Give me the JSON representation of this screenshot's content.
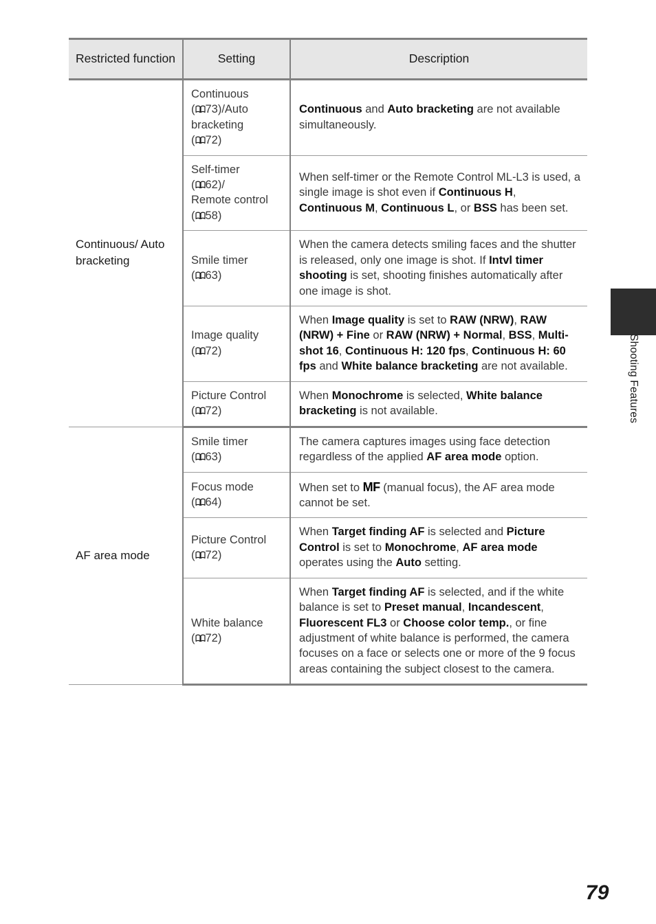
{
  "page": {
    "number": "79",
    "side_tab_label": "Shooting Features"
  },
  "table": {
    "headers": {
      "function": "Restricted function",
      "setting": "Setting",
      "description": "Description"
    },
    "groups": [
      {
        "function": "Continuous/ Auto bracketing",
        "rows": [
          {
            "setting_line1": "Continuous",
            "setting_ref1": "73",
            "setting_line1_suffix": ")/Auto",
            "setting_line2": "bracketing",
            "setting_ref2": "72",
            "description_runs": [
              {
                "t": "Continuous",
                "b": true
              },
              {
                "t": " and ",
                "b": false
              },
              {
                "t": "Auto bracketing",
                "b": true
              },
              {
                "t": " are not available simultaneously.",
                "b": false
              }
            ]
          },
          {
            "setting_line1": "Self-timer",
            "setting_ref1": "62",
            "setting_line1_suffix": ")/",
            "setting_line2": "Remote control",
            "setting_ref2": "58",
            "description_runs": [
              {
                "t": "When self-timer or the Remote Control ML-L3 is used, a single image is shot even if ",
                "b": false
              },
              {
                "t": "Continuous H",
                "b": true
              },
              {
                "t": ", ",
                "b": false
              },
              {
                "t": "Continuous M",
                "b": true
              },
              {
                "t": ", ",
                "b": false
              },
              {
                "t": "Continuous L",
                "b": true
              },
              {
                "t": ", or ",
                "b": false
              },
              {
                "t": "BSS",
                "b": true
              },
              {
                "t": " has been set.",
                "b": false
              }
            ]
          },
          {
            "setting_line1": "Smile timer",
            "setting_ref1": "63",
            "setting_line1_suffix": ")",
            "description_runs": [
              {
                "t": "When the camera detects smiling faces and the shutter is released, only one image is shot. If ",
                "b": false
              },
              {
                "t": "Intvl timer shooting",
                "b": true
              },
              {
                "t": " is set, shooting finishes automatically after one image is shot.",
                "b": false
              }
            ]
          },
          {
            "setting_line1": "Image quality",
            "setting_ref1": "72",
            "setting_line1_suffix": ")",
            "description_runs": [
              {
                "t": "When ",
                "b": false
              },
              {
                "t": "Image quality",
                "b": true
              },
              {
                "t": " is set to ",
                "b": false
              },
              {
                "t": "RAW (NRW)",
                "b": true
              },
              {
                "t": ", ",
                "b": false
              },
              {
                "t": "RAW (NRW) + Fine",
                "b": true
              },
              {
                "t": " or ",
                "b": false
              },
              {
                "t": "RAW (NRW) + Normal",
                "b": true
              },
              {
                "t": ", ",
                "b": false
              },
              {
                "t": "BSS",
                "b": true
              },
              {
                "t": ", ",
                "b": false
              },
              {
                "t": "Multi-shot 16",
                "b": true
              },
              {
                "t": ", ",
                "b": false
              },
              {
                "t": "Continuous H: 120 fps",
                "b": true
              },
              {
                "t": ", ",
                "b": false
              },
              {
                "t": "Continuous H: 60 fps",
                "b": true
              },
              {
                "t": " and ",
                "b": false
              },
              {
                "t": "White balance bracketing",
                "b": true
              },
              {
                "t": " are not available.",
                "b": false
              }
            ]
          },
          {
            "setting_line1": "Picture Control",
            "setting_ref1": "72",
            "setting_line1_suffix": ")",
            "description_runs": [
              {
                "t": "When ",
                "b": false
              },
              {
                "t": "Monochrome",
                "b": true
              },
              {
                "t": " is selected, ",
                "b": false
              },
              {
                "t": "White balance bracketing",
                "b": true
              },
              {
                "t": " is not available.",
                "b": false
              }
            ]
          }
        ]
      },
      {
        "function": "AF area mode",
        "rows": [
          {
            "setting_line1": "Smile timer",
            "setting_ref1": "63",
            "setting_line1_suffix": ")",
            "description_runs": [
              {
                "t": "The camera captures images using face detection regardless of the applied ",
                "b": false
              },
              {
                "t": "AF area mode",
                "b": true
              },
              {
                "t": " option.",
                "b": false
              }
            ]
          },
          {
            "setting_line1": "Focus mode",
            "setting_ref1": "64",
            "setting_line1_suffix": ")",
            "description_runs": [
              {
                "t": "When set to ",
                "b": false
              },
              {
                "t": "MF",
                "b": false,
                "glyph": "mf"
              },
              {
                "t": " (manual focus), the AF area mode cannot be set.",
                "b": false
              }
            ]
          },
          {
            "setting_line1": "Picture Control",
            "setting_ref1": "72",
            "setting_line1_suffix": ")",
            "description_runs": [
              {
                "t": "When ",
                "b": false
              },
              {
                "t": "Target finding AF",
                "b": true
              },
              {
                "t": " is selected and ",
                "b": false
              },
              {
                "t": "Picture Control",
                "b": true
              },
              {
                "t": " is set to ",
                "b": false
              },
              {
                "t": "Monochrome",
                "b": true
              },
              {
                "t": ", ",
                "b": false
              },
              {
                "t": "AF area mode",
                "b": true
              },
              {
                "t": " operates using the ",
                "b": false
              },
              {
                "t": "Auto",
                "b": true
              },
              {
                "t": " setting.",
                "b": false
              }
            ]
          },
          {
            "setting_line1": "White balance",
            "setting_ref1": "72",
            "setting_line1_suffix": ")",
            "description_runs": [
              {
                "t": "When ",
                "b": false
              },
              {
                "t": "Target finding AF",
                "b": true
              },
              {
                "t": " is selected, and if the white balance is set to ",
                "b": false
              },
              {
                "t": "Preset manual",
                "b": true
              },
              {
                "t": ", ",
                "b": false
              },
              {
                "t": "Incandescent",
                "b": true
              },
              {
                "t": ", ",
                "b": false
              },
              {
                "t": "Fluorescent FL3",
                "b": true
              },
              {
                "t": " or ",
                "b": false
              },
              {
                "t": "Choose color temp.",
                "b": true
              },
              {
                "t": ", or fine adjustment of white balance is performed, the camera focuses on a face or selects one or more of the 9 focus areas containing the subject closest to the camera.",
                "b": false
              }
            ]
          }
        ]
      }
    ]
  },
  "icons": {
    "page_reference": "open-book-icon",
    "manual_focus": "mf-glyph-icon"
  },
  "colors": {
    "header_background": "#e6e6e6",
    "border": "#808080",
    "inner_border": "#9a9a9a",
    "text": "#3a3a3a",
    "bold_text": "#111111",
    "side_tab": "#2e2e2e"
  }
}
